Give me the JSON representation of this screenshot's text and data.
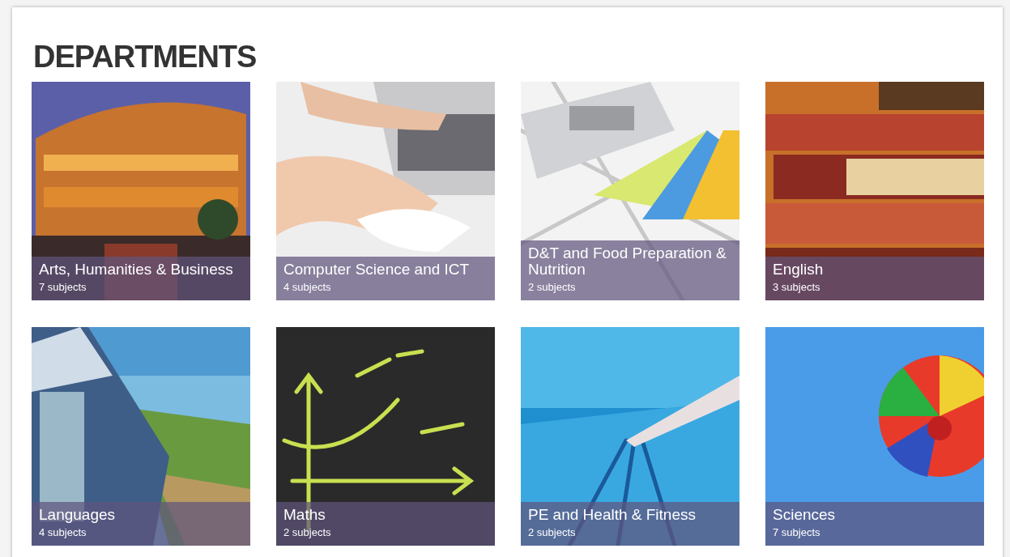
{
  "heading": "DEPARTMENTS",
  "departments": [
    {
      "title": "Arts, Humanities & Business",
      "count": "7 subjects"
    },
    {
      "title": "Computer Science and ICT",
      "count": "4 subjects"
    },
    {
      "title": "D&T and Food Preparation & Nutrition",
      "count": "2 subjects"
    },
    {
      "title": "English",
      "count": "3 subjects"
    },
    {
      "title": "Languages",
      "count": "4 subjects"
    },
    {
      "title": "Maths",
      "count": "2 subjects"
    },
    {
      "title": "PE and Health & Fitness",
      "count": "2 subjects"
    },
    {
      "title": "Sciences",
      "count": "7 subjects"
    }
  ]
}
